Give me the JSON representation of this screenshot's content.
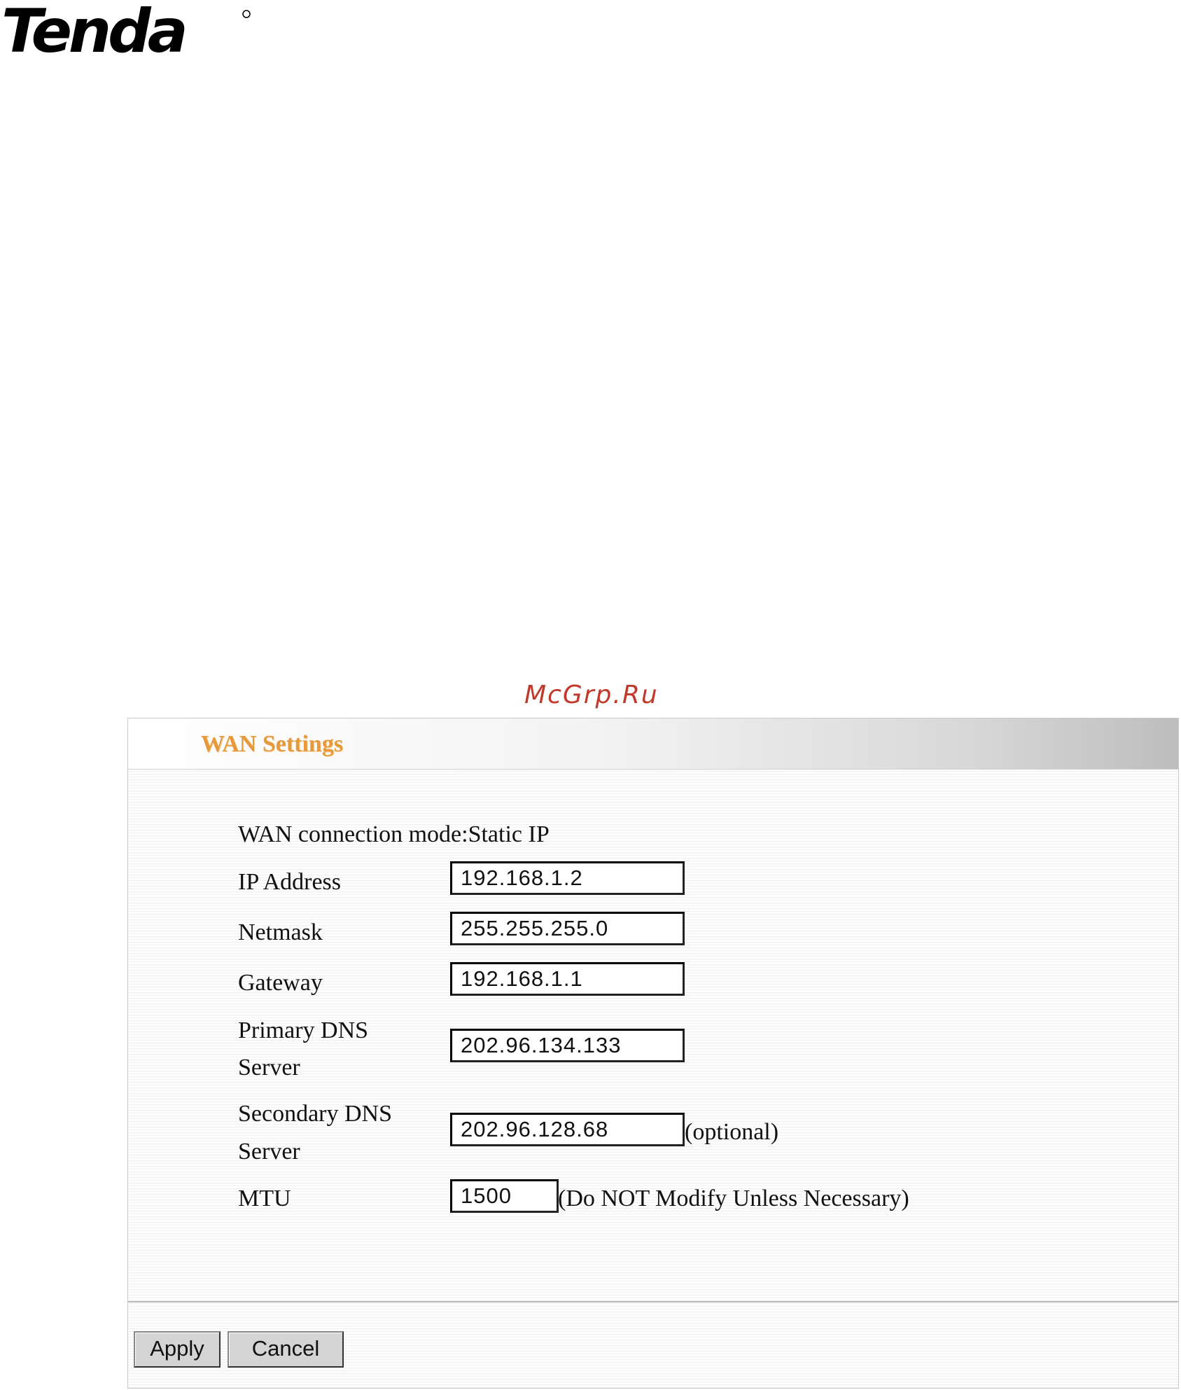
{
  "brand": {
    "logo_text": "Tenda"
  },
  "watermark": "McGrp.Ru",
  "panel": {
    "title": "WAN Settings",
    "mode_line": "WAN connection mode:Static IP",
    "fields": {
      "ip_address": {
        "label": "IP Address",
        "value": "192.168.1.2"
      },
      "netmask": {
        "label": "Netmask",
        "value": "255.255.255.0"
      },
      "gateway": {
        "label": "Gateway",
        "value": "192.168.1.1"
      },
      "primary_dns": {
        "label_line1": "Primary DNS",
        "label_line2": "Server",
        "value": "202.96.134.133"
      },
      "secondary_dns": {
        "label_line1": "Secondary DNS",
        "label_line2": "Server",
        "value": "202.96.128.68",
        "note": "(optional)"
      },
      "mtu": {
        "label": "MTU",
        "value": "1500",
        "note": "(Do NOT Modify Unless Necessary)"
      }
    },
    "buttons": {
      "apply": "Apply",
      "cancel": "Cancel"
    }
  }
}
